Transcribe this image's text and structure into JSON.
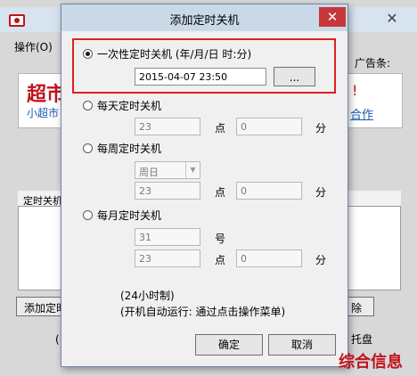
{
  "bg": {
    "menu": "操作(O)",
    "ad_label": "广告条:",
    "banner_big": "超市",
    "banner_small": "小超市",
    "banner_right": "!",
    "coop": "合作",
    "table_header": "定时关机",
    "add_button": "添加定时",
    "right_button": "除",
    "tray": "托盘",
    "paren": "(",
    "close": "✕"
  },
  "dialog": {
    "title": "添加定时关机",
    "close": "✕",
    "once": {
      "label": "一次性定时关机 (年/月/日 时:分)",
      "datetime": "2015-04-07 23:50",
      "pick_button": "..."
    },
    "daily": {
      "label": "每天定时关机",
      "hour": "23",
      "hour_unit": "点",
      "minute": "0",
      "minute_unit": "分"
    },
    "weekly": {
      "label": "每周定时关机",
      "day": "周日",
      "hour": "23",
      "hour_unit": "点",
      "minute": "0",
      "minute_unit": "分"
    },
    "monthly": {
      "label": "每月定时关机",
      "day": "31",
      "day_unit": "号",
      "hour": "23",
      "hour_unit": "点",
      "minute": "0",
      "minute_unit": "分"
    },
    "note1": "(24小时制)",
    "note2": "(开机自动运行: 通过点击操作菜单)",
    "ok": "确定",
    "cancel": "取消"
  },
  "watermark": "综合信息"
}
